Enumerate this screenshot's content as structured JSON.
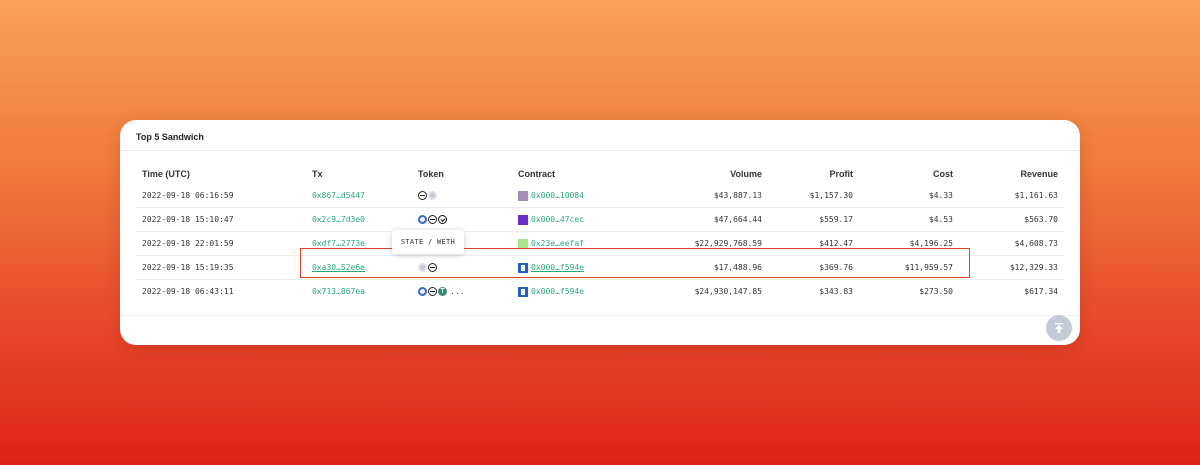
{
  "card": {
    "title": "Top 5 Sandwich"
  },
  "table": {
    "headers": {
      "time": "Time (UTC)",
      "tx": "Tx",
      "token": "Token",
      "contract": "Contract",
      "volume": "Volume",
      "profit": "Profit",
      "cost": "Cost",
      "revenue": "Revenue"
    },
    "rows": [
      {
        "time": "2022-09-18 06:16:59",
        "tx": "0x867…d5447",
        "tokens": [
          "dark-token-icon",
          "grey-token-icon"
        ],
        "contract": "0x000…10084",
        "contract_icon": "purple",
        "volume": "$43,887.13",
        "profit": "$1,157.30",
        "cost": "$4.33",
        "revenue": "$1,161.63"
      },
      {
        "time": "2022-09-18 15:10:47",
        "tx": "0x2c9…7d3e0",
        "tokens": [
          "blue-token-icon",
          "dark-token-icon",
          "check-token-icon"
        ],
        "contract": "0x000…47cec",
        "contract_icon": "violet",
        "volume": "$47,664.44",
        "profit": "$559.17",
        "cost": "$4.53",
        "revenue": "$563.70"
      },
      {
        "time": "2022-09-18 22:01:59",
        "tx": "0xdf7…2773e",
        "tokens": [],
        "contract": "0x23e…eefaf",
        "contract_icon": "lime",
        "volume": "$22,929,768.59",
        "profit": "$412.47",
        "cost": "$4,196.25",
        "revenue": "$4,608.73"
      },
      {
        "time": "2022-09-18 15:19:35",
        "tx": "0xa30…52e6e",
        "tokens": [
          "grey-token-icon",
          "dark-token-icon"
        ],
        "contract": "0x000…f594e",
        "contract_icon": "navy",
        "volume": "$17,488.96",
        "profit": "$369.76",
        "cost": "$11,959.57",
        "revenue": "$12,329.33"
      },
      {
        "time": "2022-09-18 06:43:11",
        "tx": "0x713…867ea",
        "tokens": [
          "blue-token-icon",
          "dark-token-icon",
          "green-t-token-icon"
        ],
        "more": "...",
        "contract": "0x000…f594e",
        "contract_icon": "navy",
        "volume": "$24,930,147.85",
        "profit": "$343.83",
        "cost": "$273.50",
        "revenue": "$617.34"
      }
    ]
  },
  "tooltip": {
    "text": "STATE / WETH"
  },
  "scroll_top": {
    "icon": "arrow-up-icon"
  },
  "colors": {
    "link": "#2aa876",
    "highlight": "#e0452a"
  }
}
